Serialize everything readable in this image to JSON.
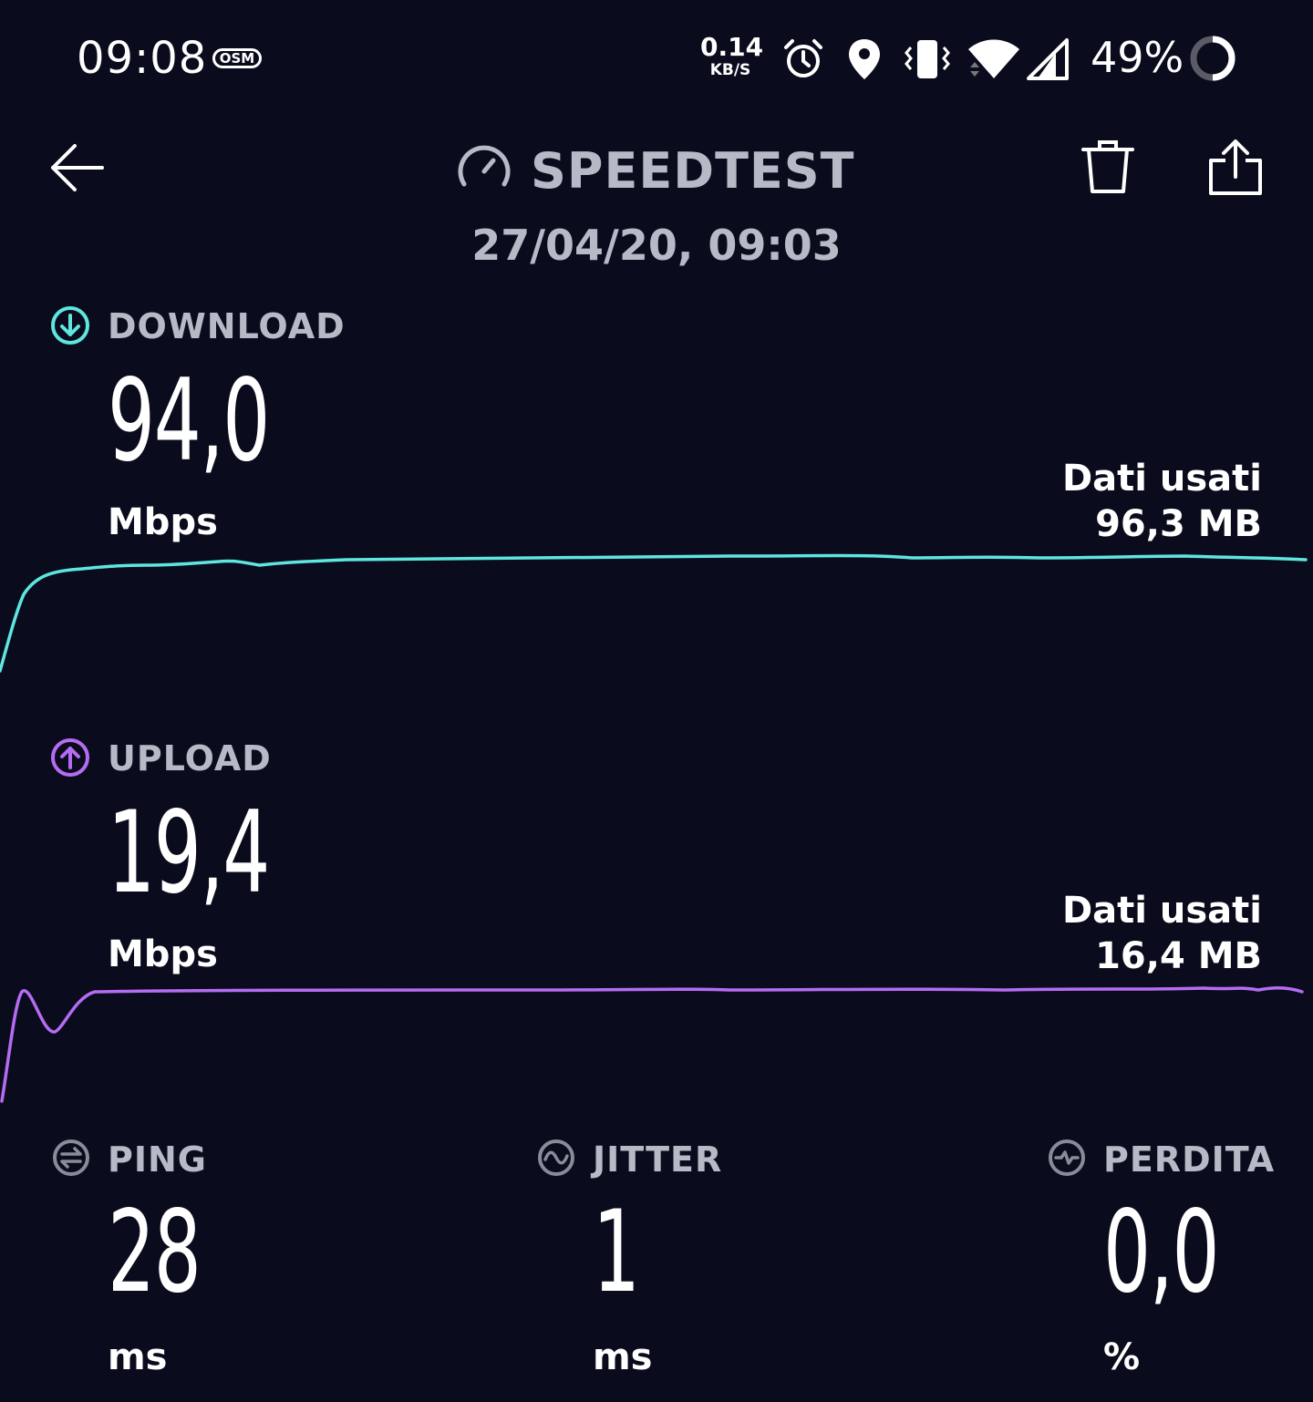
{
  "status_bar": {
    "time": "09:08",
    "carrier": "OSM",
    "net_speed_value": "0.14",
    "net_speed_unit": "KB/S",
    "battery_percent": "49%",
    "icons": [
      "alarm-icon",
      "location-icon",
      "vibrate-icon",
      "wifi-icon",
      "signal-icon",
      "battery-ring-icon"
    ]
  },
  "header": {
    "title": "SPEEDTEST",
    "date": "27/04/20, 09:03",
    "icons": [
      "back-arrow-icon",
      "speedometer-icon",
      "trash-icon",
      "share-icon"
    ]
  },
  "download": {
    "label": "DOWNLOAD",
    "value": "94,0",
    "unit": "Mbps",
    "data_used_label": "Dati usati",
    "data_used_value": "96,3 MB",
    "color": "#5ee6df"
  },
  "upload": {
    "label": "UPLOAD",
    "value": "19,4",
    "unit": "Mbps",
    "data_used_label": "Dati usati",
    "data_used_value": "16,4 MB",
    "color": "#b56cf2"
  },
  "ping": {
    "label": "PING",
    "value": "28",
    "unit": "ms"
  },
  "jitter": {
    "label": "JITTER",
    "value": "1",
    "unit": "ms"
  },
  "loss": {
    "label": "PERDITA",
    "value": "0,0",
    "unit": "%"
  },
  "colors": {
    "background": "#0a0c1d",
    "label_gray": "#b8b9c6",
    "icon_gray": "#8a8b99"
  }
}
